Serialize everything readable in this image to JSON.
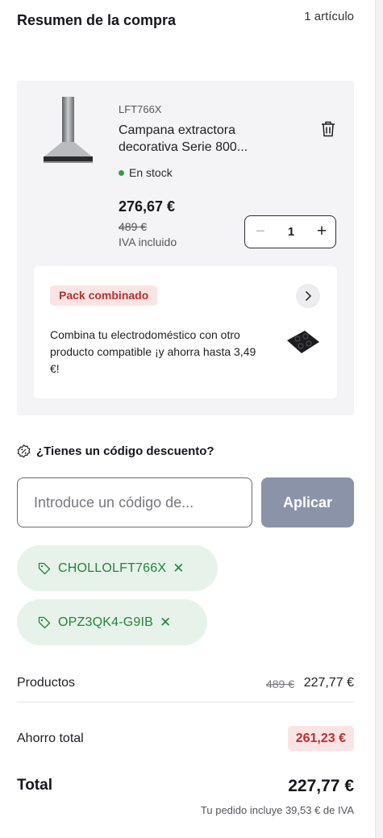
{
  "header": {
    "title": "Resumen de la compra",
    "item_count": "1 artículo"
  },
  "product": {
    "sku": "LFT766X",
    "name": "Campana extractora decorativa Serie 800...",
    "stock": "En stock",
    "price": "276,67 €",
    "old_price": "489 €",
    "vat_note": "IVA incluido",
    "quantity": "1",
    "stock_color": "#2ea043"
  },
  "pack": {
    "badge": "Pack combinado",
    "text": "Combina tu electrodoméstico con otro producto compatible ¡y ahorra hasta 3,49 €!"
  },
  "discount": {
    "title": "¿Tienes un código descuento?",
    "placeholder": "Introduce un código de...",
    "apply_label": "Aplicar",
    "codes": [
      "CHOLLOLFT766X",
      "OPZ3QK4-G9IB"
    ]
  },
  "summary": {
    "products_label": "Productos",
    "products_old": "489 €",
    "products_value": "227,77 €",
    "savings_label": "Ahorro total",
    "savings_value": "261,23 €",
    "total_label": "Total",
    "total_value": "227,77 €",
    "vat_note": "Tu pedido incluye 39,53 € de IVA"
  },
  "colors": {
    "accent_red": "#b8302e",
    "chip_green": "#21843b",
    "button_grey": "#8b93a8"
  }
}
